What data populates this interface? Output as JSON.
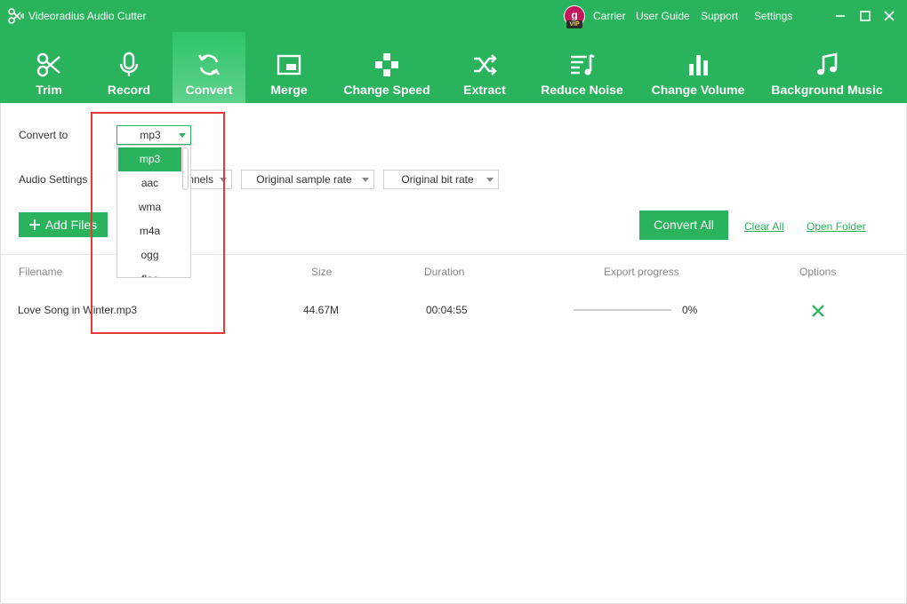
{
  "titlebar": {
    "title": "Videoradius Audio Cutter",
    "vip_letter": "g",
    "vip_tag": "VIP",
    "links": [
      "Carrier",
      "User Guide",
      "Support",
      "Settings"
    ]
  },
  "toolbar": {
    "items": [
      {
        "label": "Trim",
        "icon": "scissors-icon"
      },
      {
        "label": "Record",
        "icon": "microphone-icon"
      },
      {
        "label": "Convert",
        "icon": "convert-arrows-icon",
        "active": true
      },
      {
        "label": "Merge",
        "icon": "merge-icon"
      },
      {
        "label": "Change Speed",
        "icon": "gamepad-icon"
      },
      {
        "label": "Extract",
        "icon": "shuffle-icon"
      },
      {
        "label": "Reduce Noise",
        "icon": "noise-icon"
      },
      {
        "label": "Change Volume",
        "icon": "bars-icon"
      },
      {
        "label": "Background Music",
        "icon": "music-note-icon"
      }
    ]
  },
  "form": {
    "convert_to_label": "Convert to",
    "format_value": "mp3",
    "audio_settings_label": "Audio Settings",
    "channels_value": "Original channels",
    "channels_visible_text": "nnels",
    "sample_rate_value": "Original sample rate",
    "bit_rate_value": "Original bit rate"
  },
  "actions": {
    "add_files": "Add Files",
    "convert_all": "Convert All",
    "clear_all": "Clear All",
    "open_folder": "Open Folder"
  },
  "table": {
    "headers": [
      "Filename",
      "Size",
      "Duration",
      "Export progress",
      "Options"
    ],
    "rows": [
      {
        "filename": "Love Song in Winter.mp3",
        "size": "44.67M",
        "duration": "00:04:55",
        "progress": "0%",
        "progress_fraction": 0
      }
    ]
  },
  "dropdown": {
    "options": [
      "mp3",
      "aac",
      "wma",
      "m4a",
      "ogg",
      "flac"
    ],
    "selected": "mp3"
  },
  "colors": {
    "brand": "#29b35c",
    "highlight": "#e53935"
  }
}
